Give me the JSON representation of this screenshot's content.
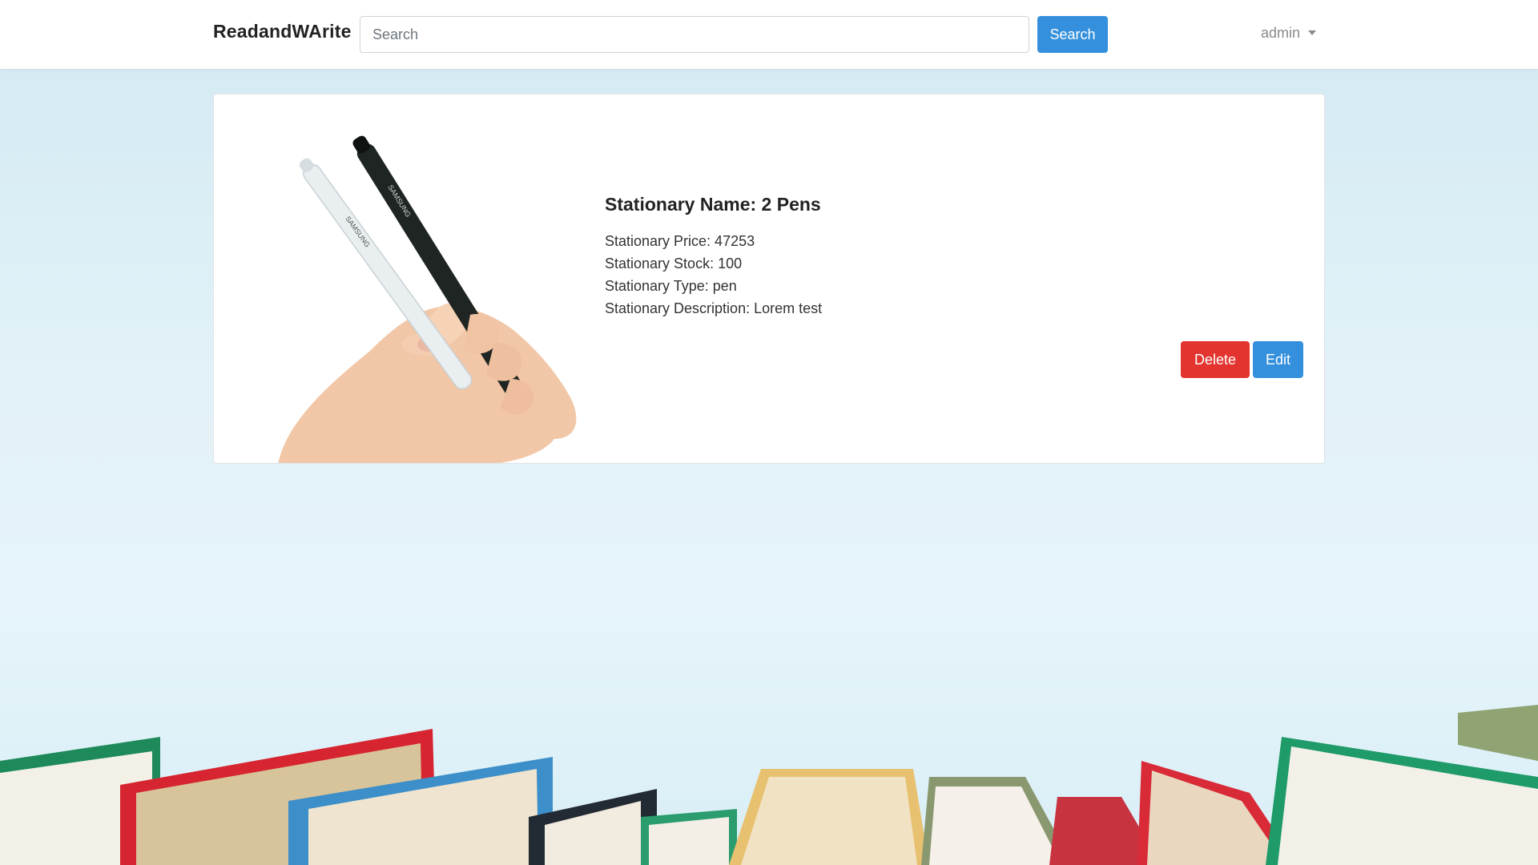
{
  "navbar": {
    "brand": "ReadandWArite",
    "search_placeholder": "Search",
    "search_value": "",
    "search_button": "Search",
    "user": "admin"
  },
  "product": {
    "image_icon": "pens-in-hand-image",
    "image_text": "SAMSUNG",
    "name_line": "Stationary Name: 2 Pens",
    "price_line": "Stationary Price: 47253",
    "stock_line": "Stationary Stock: 100",
    "type_line": "Stationary Type: pen",
    "description_line": "Stationary Description: Lorem test"
  },
  "actions": {
    "delete": "Delete",
    "edit": "Edit"
  },
  "colors": {
    "primary": "#3490dc",
    "danger": "#e3342f",
    "background": "#e3f2f8"
  }
}
